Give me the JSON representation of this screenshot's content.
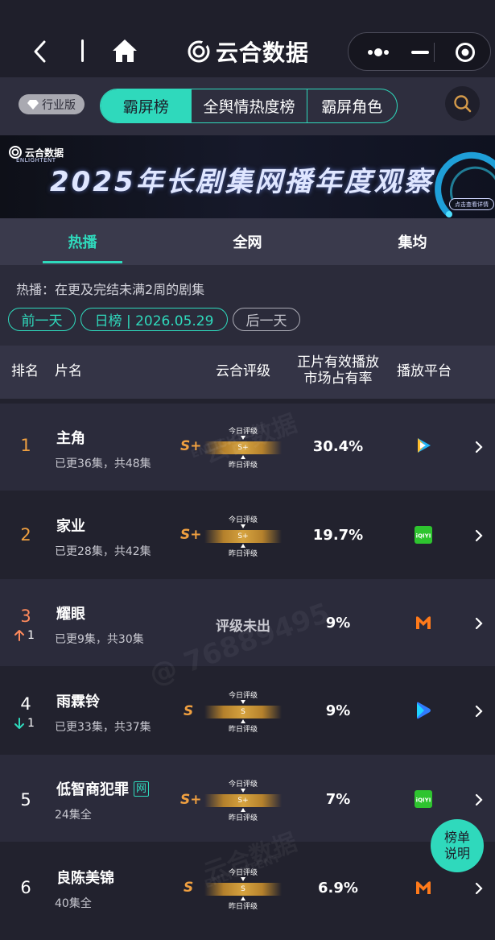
{
  "nav": {
    "brand": "云合数据"
  },
  "toolbar": {
    "edition": "行业版",
    "segments": [
      "霸屏榜",
      "全舆情热度榜",
      "霸屏角色"
    ]
  },
  "banner": {
    "logo_text": "云合数据",
    "logo_sub": "ENLIGHTENT",
    "title": "2025年长剧集网播年度观察",
    "tag": "点击查看详情"
  },
  "tabs": [
    "热播",
    "全网",
    "集均"
  ],
  "info": {
    "desc": "热播：在更及完结未满2周的剧集",
    "prev": "前一天",
    "date": "日榜 | 2026.05.29",
    "next": "后一天"
  },
  "header": {
    "rank": "排名",
    "name": "片名",
    "rating": "云合评级",
    "share_line1": "正片有效播放",
    "share_line2": "市场占有率",
    "platform": "播放平台"
  },
  "gauge_labels": {
    "today": "今日评级",
    "yesterday": "昨日评级"
  },
  "rows": [
    {
      "rank": "1",
      "title": "主角",
      "sub": "已更36集，共48集",
      "grade": "S+",
      "gauge": "S+",
      "share": "30.4%",
      "platform": "tencent-video-icon"
    },
    {
      "rank": "2",
      "title": "家业",
      "sub": "已更28集，共42集",
      "grade": "S+",
      "gauge": "S+",
      "share": "19.7%",
      "platform": "iqiyi-icon"
    },
    {
      "rank": "3",
      "delta": "1",
      "delta_dir": "up",
      "title": "耀眼",
      "sub": "已更9集，共30集",
      "grade": "",
      "nograde": "评级未出",
      "share": "9%",
      "platform": "mango-tv-icon"
    },
    {
      "rank": "4",
      "delta": "1",
      "delta_dir": "down",
      "title": "雨霖铃",
      "sub": "已更33集，共37集",
      "grade": "S",
      "gauge": "S",
      "share": "9%",
      "platform": "youku-icon"
    },
    {
      "rank": "5",
      "title": "低智商犯罪",
      "badge": "网",
      "sub": "24集全",
      "grade": "S+",
      "gauge": "S+",
      "share": "7%",
      "platform": "iqiyi-icon"
    },
    {
      "rank": "6",
      "title": "良陈美锦",
      "sub": "40集全",
      "grade": "S",
      "gauge": "S",
      "share": "6.9%",
      "platform": "mango-tv-icon"
    }
  ],
  "fab": {
    "line1": "榜单",
    "line2": "说明"
  },
  "watermarks": [
    "云合数据",
    "ENLIGHTENT",
    "@ 76889495"
  ],
  "colors": {
    "accent": "#2fd9bc",
    "grade": "#f0a040",
    "rank_top": "#f0a040",
    "rank_3": "#ff8a5c"
  }
}
